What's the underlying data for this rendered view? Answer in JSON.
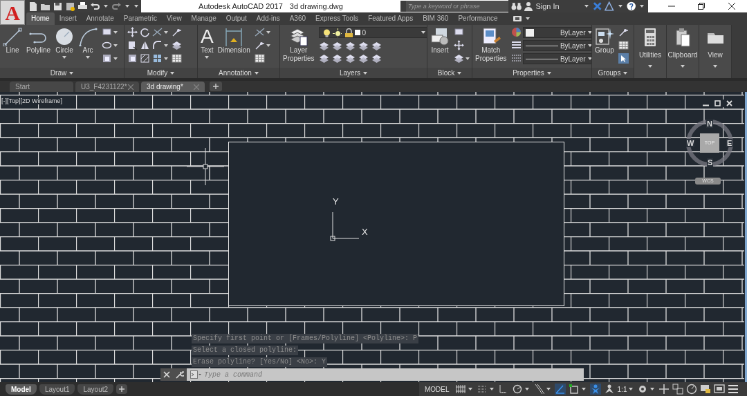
{
  "app_menu": {
    "glyph": "A"
  },
  "window": {
    "app_title": "Autodesk AutoCAD 2017",
    "file_title": "3d drawing.dwg"
  },
  "search": {
    "placeholder": "Type a keyword or phrase"
  },
  "account": {
    "label": "Sign In"
  },
  "ribbon_tabs": [
    {
      "label": "Home",
      "selected": true
    },
    {
      "label": "Insert",
      "selected": false
    },
    {
      "label": "Annotate",
      "selected": false
    },
    {
      "label": "Parametric",
      "selected": false
    },
    {
      "label": "View",
      "selected": false
    },
    {
      "label": "Manage",
      "selected": false
    },
    {
      "label": "Output",
      "selected": false
    },
    {
      "label": "Add-ins",
      "selected": false
    },
    {
      "label": "A360",
      "selected": false
    },
    {
      "label": "Express Tools",
      "selected": false
    },
    {
      "label": "Featured Apps",
      "selected": false
    },
    {
      "label": "BIM 360",
      "selected": false
    },
    {
      "label": "Performance",
      "selected": false
    }
  ],
  "ribbon_panels": [
    {
      "kind": "draw",
      "title": "Draw",
      "tools": [
        {
          "label": "Line",
          "dropdown": false
        },
        {
          "label": "Polyline",
          "dropdown": false
        },
        {
          "label": "Circle",
          "dropdown": true
        },
        {
          "label": "Arc",
          "dropdown": true
        }
      ]
    },
    {
      "kind": "modify",
      "title": "Modify"
    },
    {
      "kind": "annotation",
      "title": "Annotation",
      "tools": [
        {
          "label": "Text",
          "glyph": "A",
          "dropdown": true
        },
        {
          "label": "Dimension",
          "dropdown": false
        }
      ]
    },
    {
      "kind": "layers",
      "title": "Layers",
      "tools": [
        {
          "label": "Layer Properties",
          "dropdown": false
        }
      ],
      "dropdowns": [
        "0"
      ]
    },
    {
      "kind": "block",
      "title": "Block",
      "tools": [
        {
          "label": "Insert",
          "dropdown": false
        }
      ]
    },
    {
      "kind": "properties",
      "title": "Properties",
      "tools": [
        {
          "label": "Match Properties",
          "dropdown": false
        }
      ],
      "dropdowns": [
        "ByLayer",
        "ByLayer",
        "ByLayer"
      ]
    },
    {
      "kind": "groups",
      "title": "Groups",
      "tools": [
        {
          "label": "Group",
          "dropdown": false
        }
      ]
    },
    {
      "kind": "utilities",
      "tools": [
        {
          "label": "Utilities",
          "dropdown": true
        }
      ]
    },
    {
      "kind": "clipboard",
      "tools": [
        {
          "label": "Clipboard",
          "dropdown": true
        }
      ]
    },
    {
      "kind": "view",
      "tools": [
        {
          "label": "View",
          "dropdown": true
        }
      ]
    }
  ],
  "file_tabs": [
    {
      "label": "Start",
      "selected": false,
      "closable": false
    },
    {
      "label": "U3_F4231122*",
      "selected": false,
      "closable": true
    },
    {
      "label": "3d drawing*",
      "selected": true,
      "closable": true
    }
  ],
  "viewport": {
    "label": "[-][Top][2D Wireframe]"
  },
  "viewcube": {
    "north": "N",
    "west": "W",
    "east": "E",
    "south": "S",
    "face": "TOP",
    "ucs": "WCS"
  },
  "ucs_icon": {
    "y_label": "Y",
    "x_label": "X"
  },
  "command_history": [
    "Specify first point or [Frames/Polyline] <Polyline>: P",
    "Select a closed polyline:",
    "Erase polyline? [Yes/No] <No>: Y"
  ],
  "command_line": {
    "placeholder": "Type a command"
  },
  "layout_tabs": [
    {
      "label": "Model",
      "selected": true
    },
    {
      "label": "Layout1",
      "selected": false
    },
    {
      "label": "Layout2",
      "selected": false
    }
  ],
  "status_bar": {
    "space": "MODEL",
    "annotation_scale": "1:1",
    "toggles": [
      {
        "kind": "grid",
        "on": false
      },
      {
        "kind": "snap",
        "on": false
      },
      {
        "kind": "infer",
        "on": false
      },
      {
        "kind": "polar",
        "on": false
      },
      {
        "kind": "ortho",
        "on": false
      },
      {
        "kind": "isodraft",
        "on": true
      },
      {
        "kind": "osnap",
        "on": false
      },
      {
        "kind": "annovis",
        "on": true
      },
      {
        "kind": "autoscale",
        "on": false
      }
    ]
  }
}
